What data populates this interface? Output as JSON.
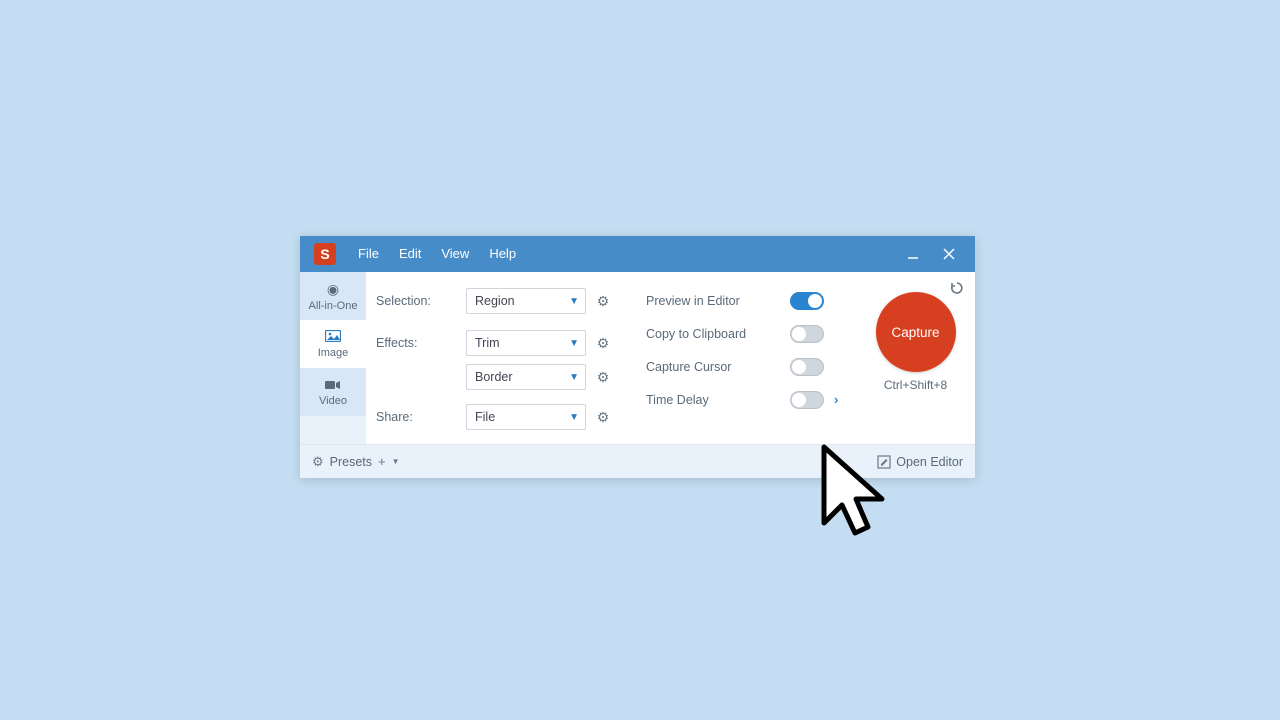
{
  "app": {
    "logo_letter": "S"
  },
  "menus": {
    "file": "File",
    "edit": "Edit",
    "view": "View",
    "help": "Help"
  },
  "tabs": {
    "all_in_one": "All-in-One",
    "image": "Image",
    "video": "Video"
  },
  "labels": {
    "selection": "Selection:",
    "effects": "Effects:",
    "share": "Share:"
  },
  "dropdowns": {
    "selection": "Region",
    "effect1": "Trim",
    "effect2": "Border",
    "share": "File"
  },
  "toggles": {
    "preview": "Preview in Editor",
    "clipboard": "Copy to Clipboard",
    "cursor": "Capture Cursor",
    "delay": "Time Delay"
  },
  "capture": {
    "label": "Capture",
    "hotkey": "Ctrl+Shift+8"
  },
  "footer": {
    "presets": "Presets",
    "open_editor": "Open Editor"
  }
}
